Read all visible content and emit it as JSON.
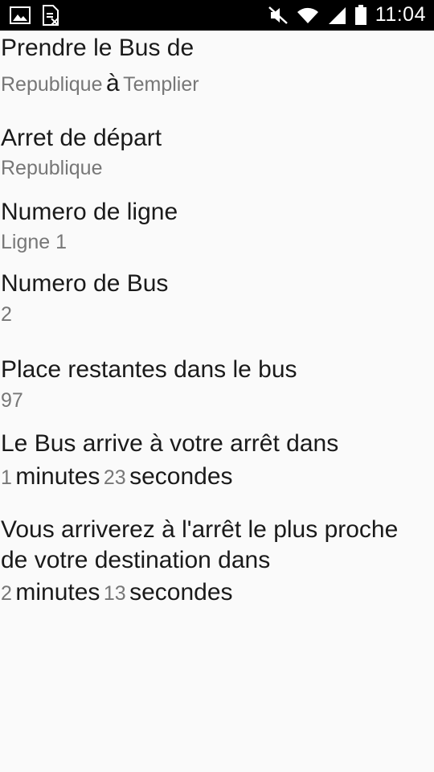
{
  "status_bar": {
    "time": "11:04",
    "icons": [
      "image-icon",
      "data-saver-icon",
      "mute-icon",
      "wifi-icon",
      "signal-icon",
      "battery-icon"
    ]
  },
  "trip": {
    "title": "Prendre le Bus de",
    "from": "Republique",
    "connector": "à",
    "to": "Templier"
  },
  "departure": {
    "label": "Arret de départ",
    "value": "Republique"
  },
  "line": {
    "label": "Numero de ligne",
    "value": "Ligne 1"
  },
  "bus": {
    "label": "Numero de Bus",
    "value": "2"
  },
  "seats": {
    "label": "Place restantes dans le bus",
    "value": "97"
  },
  "arrival": {
    "label": "Le Bus arrive à votre arrêt dans",
    "minutes": "1",
    "minutes_word": "minutes",
    "seconds": "23",
    "seconds_word": "secondes"
  },
  "destination": {
    "label": "Vous arriverez à l'arrêt le plus proche de votre destination dans",
    "minutes": "2",
    "minutes_word": "minutes",
    "seconds": "13",
    "seconds_word": "secondes"
  }
}
